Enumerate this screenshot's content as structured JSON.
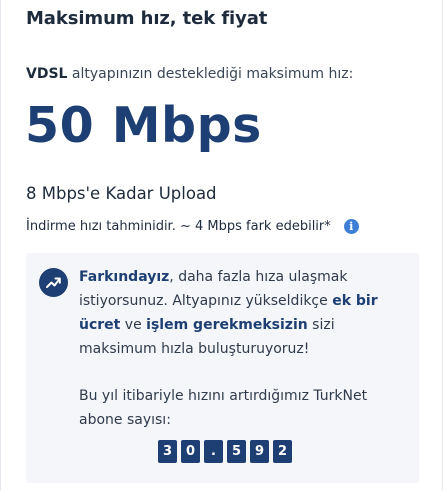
{
  "header": {
    "title": "Maksimum hız, tek fiyat"
  },
  "infrastructure": {
    "type": "VDSL",
    "text": " altyapınızın desteklediği maksimum hız:"
  },
  "speed": {
    "value": "50 Mbps"
  },
  "upload": {
    "text": "8 Mbps'e Kadar Upload"
  },
  "note": {
    "text": "İndirme hızı tahminidir. ~ 4 Mbps fark edebilir*",
    "info_icon": "info-icon",
    "info_icon_glyph": "i"
  },
  "awareness": {
    "icon": "trending-up-icon",
    "part1_bold": "Farkındayız",
    "part2": ", daha fazla hıza ulaşmak istiyorsunuz. Altyapınız yükseldikçe ",
    "part3_bold": "ek bir ücret",
    "part4": " ve ",
    "part5_bold": "işlem gerekmeksizin",
    "part6": " sizi maksimum hızla buluşturuyoruz!",
    "counter_label": "Bu yıl itibariyle hızını artırdığımız TurkNet abone sayısı:",
    "counter_digits": [
      "3",
      "0",
      ".",
      "5",
      "9",
      "2"
    ]
  },
  "colors": {
    "accent": "#1d3f73",
    "info": "#3e7fd6",
    "box_bg": "#f4f6f9"
  }
}
